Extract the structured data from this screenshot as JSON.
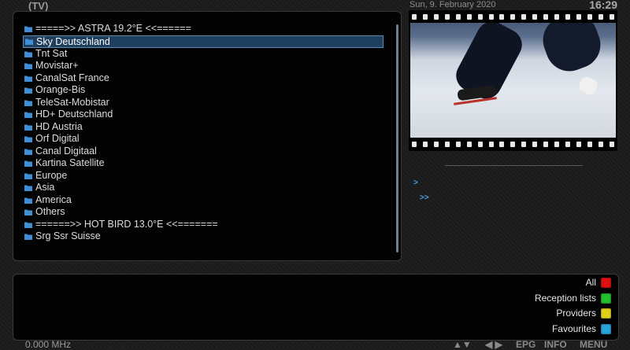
{
  "header": {
    "mode": "(TV)",
    "date": "Sun, 9. February 2020",
    "time": "16:29"
  },
  "channel_list": {
    "selected_index": 1,
    "items": [
      {
        "label": "=====>> ASTRA 19.2°E <<======",
        "icon": "folder-icon"
      },
      {
        "label": "Sky Deutschland",
        "icon": "folder-icon"
      },
      {
        "label": "Tnt Sat",
        "icon": "folder-icon"
      },
      {
        "label": "Movistar+",
        "icon": "folder-icon"
      },
      {
        "label": "CanalSat France",
        "icon": "folder-icon"
      },
      {
        "label": "Orange-Bis",
        "icon": "folder-icon"
      },
      {
        "label": "TeleSat-Mobistar",
        "icon": "folder-icon"
      },
      {
        "label": "HD+ Deutschland",
        "icon": "folder-icon"
      },
      {
        "label": "HD Austria",
        "icon": "folder-icon"
      },
      {
        "label": "Orf Digital",
        "icon": "folder-icon"
      },
      {
        "label": "Canal Digitaal",
        "icon": "folder-icon"
      },
      {
        "label": "Kartina Satellite",
        "icon": "folder-icon"
      },
      {
        "label": "Europe",
        "icon": "folder-icon"
      },
      {
        "label": "Asia",
        "icon": "folder-icon"
      },
      {
        "label": "America",
        "icon": "folder-icon"
      },
      {
        "label": "Others",
        "icon": "folder-icon"
      },
      {
        "label": "======>> HOT BIRD 13.0°E <<=======",
        "icon": "folder-icon"
      },
      {
        "label": "Srg Ssr Suisse",
        "icon": "folder-icon"
      }
    ]
  },
  "info": {
    "now_marker": ">",
    "next_marker": ">>"
  },
  "color_keys": {
    "all": {
      "label": "All",
      "color": "#e01010"
    },
    "reception": {
      "label": "Reception lists",
      "color": "#22c02a"
    },
    "providers": {
      "label": "Providers",
      "color": "#e0d21a"
    },
    "favourites": {
      "label": "Favourites",
      "color": "#2aa4dc"
    }
  },
  "footer": {
    "frequency": "0.000 MHz",
    "updown": "▲▼",
    "leftright": "◀ ▶",
    "epg": "EPG",
    "info": "INFO",
    "menu": "MENU"
  },
  "colors": {
    "accent": "#4ea3e6",
    "selection_bg": "#1f3f5f",
    "folder": "#3f8fd6"
  }
}
